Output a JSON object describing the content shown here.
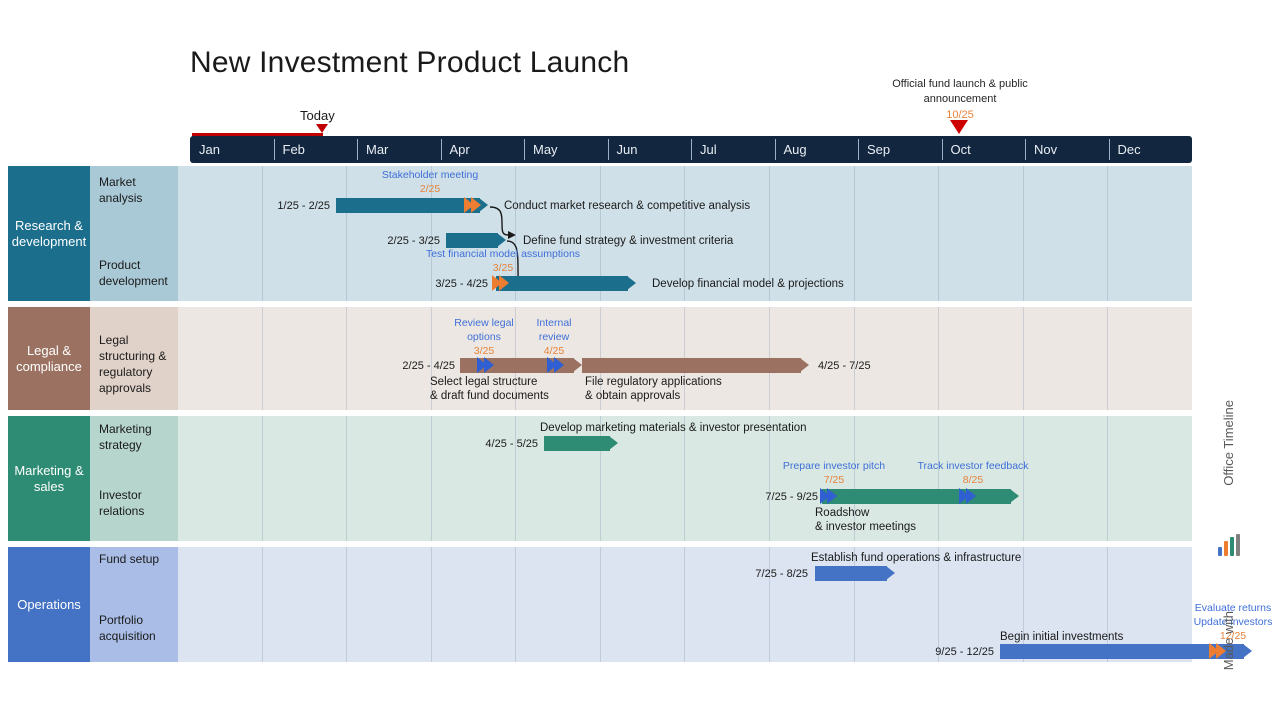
{
  "title": "New Investment Product Launch",
  "today": {
    "label": "Today",
    "marker_color": "#c00000"
  },
  "top_milestone": {
    "label_line1": "Official fund launch & public",
    "label_line2": "announcement",
    "date": "10/25",
    "marker_color": "#cc0000"
  },
  "timescale": {
    "months": [
      "Jan",
      "Feb",
      "Mar",
      "Apr",
      "May",
      "Jun",
      "Jul",
      "Aug",
      "Sep",
      "Oct",
      "Nov",
      "Dec"
    ],
    "header_bg": "#12263f",
    "header_text": "#e9eef4"
  },
  "branding": {
    "made_with": "Made with",
    "product": "Office Timeline"
  },
  "chart_data": {
    "type": "gantt",
    "title": "New Investment Product Launch",
    "x_axis": {
      "type": "months",
      "ticks": [
        "Jan",
        "Feb",
        "Mar",
        "Apr",
        "May",
        "Jun",
        "Jul",
        "Aug",
        "Sep",
        "Oct",
        "Nov",
        "Dec"
      ],
      "range": [
        "1/25",
        "12/25"
      ]
    },
    "today_marker": "2/20/25",
    "swimlanes": [
      {
        "name": "Research & development",
        "color": "#1b6e8c",
        "row_bg": "#a9c9d6",
        "track_bg": "#cfe0e8",
        "rows": [
          {
            "name": "Market analysis",
            "tasks": [
              {
                "label": "Conduct market research & competitive analysis",
                "dates": "1/25 - 2/25",
                "start": "1/25",
                "end": "2/25",
                "color": "#1b6e8c"
              }
            ],
            "milestones": [
              {
                "label": "Stakeholder meeting",
                "date": "2/25",
                "color": "#ed7d31"
              }
            ]
          },
          {
            "name": "Product development",
            "tasks": [
              {
                "label": "Define fund strategy & investment criteria",
                "dates": "2/25 - 3/25",
                "start": "2/25",
                "end": "3/25",
                "color": "#1b6e8c"
              },
              {
                "label": "Develop financial model & projections",
                "dates": "3/25 - 4/25",
                "start": "3/25",
                "end": "4/25",
                "color": "#1b6e8c"
              }
            ],
            "milestones": [
              {
                "label": "Test financial model assumptions",
                "date": "3/25",
                "color": "#ed7d31"
              }
            ]
          }
        ]
      },
      {
        "name": "Legal & compliance",
        "color": "#9b7261",
        "row_bg": "#e0d2c9",
        "track_bg": "#ece7e2",
        "rows": [
          {
            "name": "Legal structuring & regulatory approvals",
            "tasks": [
              {
                "label": "Select legal structure & draft fund documents",
                "dates": "2/25 - 4/25",
                "start": "2/25",
                "end": "4/25",
                "color": "#9b7261"
              },
              {
                "label": "File regulatory applications & obtain approvals",
                "dates": "4/25 - 7/25",
                "start": "4/25",
                "end": "7/25",
                "color": "#9b7261"
              }
            ],
            "milestones": [
              {
                "label": "Review legal options",
                "date": "3/25",
                "color": "#2f5fd0"
              },
              {
                "label": "Internal review",
                "date": "4/25",
                "color": "#2f5fd0"
              }
            ]
          }
        ]
      },
      {
        "name": "Marketing & sales",
        "color": "#2e8b74",
        "row_bg": "#b6d6cd",
        "track_bg": "#d9e8e3",
        "rows": [
          {
            "name": "Marketing strategy",
            "tasks": [
              {
                "label": "Develop marketing materials & investor presentation",
                "dates": "4/25 - 5/25",
                "start": "4/25",
                "end": "5/25",
                "color": "#2e8b74"
              }
            ],
            "milestones": []
          },
          {
            "name": "Investor relations",
            "tasks": [
              {
                "label": "Roadshow & investor meetings",
                "dates": "7/25 - 9/25",
                "start": "7/25",
                "end": "9/25",
                "color": "#2e8b74"
              }
            ],
            "milestones": [
              {
                "label": "Prepare investor pitch",
                "date": "7/25",
                "color": "#2f5fd0"
              },
              {
                "label": "Track investor feedback",
                "date": "8/25",
                "color": "#2f5fd0"
              }
            ]
          }
        ]
      },
      {
        "name": "Operations",
        "color": "#4472c4",
        "row_bg": "#a9bde6",
        "track_bg": "#dce4f2",
        "rows": [
          {
            "name": "Fund setup",
            "tasks": [
              {
                "label": "Establish fund operations & infrastructure",
                "dates": "7/25 - 8/25",
                "start": "7/25",
                "end": "8/25",
                "color": "#4472c4"
              }
            ],
            "milestones": []
          },
          {
            "name": "Portfolio acquisition",
            "tasks": [
              {
                "label": "Begin initial investments",
                "dates": "9/25 - 12/25",
                "start": "9/25",
                "end": "12/25",
                "color": "#4472c4"
              }
            ],
            "milestones": [
              {
                "label_line1": "Evaluate returns",
                "label_line2": "Update investors",
                "date": "12/25",
                "color": "#ed7d31"
              }
            ]
          }
        ]
      }
    ]
  },
  "lane1": {
    "title": "Research & development",
    "row1_name": "Market analysis",
    "row2_name": "Product development",
    "t1_label": "Conduct market research & competitive analysis",
    "t1_dates": "1/25 - 2/25",
    "m1_label": "Stakeholder meeting",
    "m1_date": "2/25",
    "t2_label": "Define fund strategy & investment criteria",
    "t2_dates": "2/25 - 3/25",
    "m2_label": "Test financial model assumptions",
    "m2_date": "3/25",
    "t3_label": "Develop financial model & projections",
    "t3_dates": "3/25 - 4/25"
  },
  "lane2": {
    "title": "Legal & compliance",
    "row1_name": "Legal structuring & regulatory approvals",
    "t1_dates": "2/25 - 4/25",
    "t1_label_l1": "Select legal structure",
    "t1_label_l2": "& draft fund documents",
    "m1_label_l1": "Review legal",
    "m1_label_l2": "options",
    "m1_date": "3/25",
    "m2_label_l1": "Internal",
    "m2_label_l2": "review",
    "m2_date": "4/25",
    "t2_label_l1": "File regulatory applications",
    "t2_label_l2": "& obtain approvals",
    "t2_dates": "4/25 - 7/25"
  },
  "lane3": {
    "title": "Marketing & sales",
    "row1_name": "Marketing strategy",
    "row2_name": "Investor relations",
    "t1_label": "Develop marketing materials & investor presentation",
    "t1_dates": "4/25 - 5/25",
    "m1_label": "Prepare investor pitch",
    "m1_date": "7/25",
    "m2_label": "Track investor feedback",
    "m2_date": "8/25",
    "t2_dates": "7/25 - 9/25",
    "t2_label_l1": "Roadshow",
    "t2_label_l2": "& investor meetings"
  },
  "lane4": {
    "title": "Operations",
    "row1_name": "Fund setup",
    "row2_name": "Portfolio acquisition",
    "t1_label": "Establish fund operations & infrastructure",
    "t1_dates": "7/25 - 8/25",
    "t2_label": "Begin initial investments",
    "t2_dates": "9/25 - 12/25",
    "m1_label_l1": "Evaluate returns",
    "m1_label_l2": "Update investors",
    "m1_date": "12/25"
  }
}
